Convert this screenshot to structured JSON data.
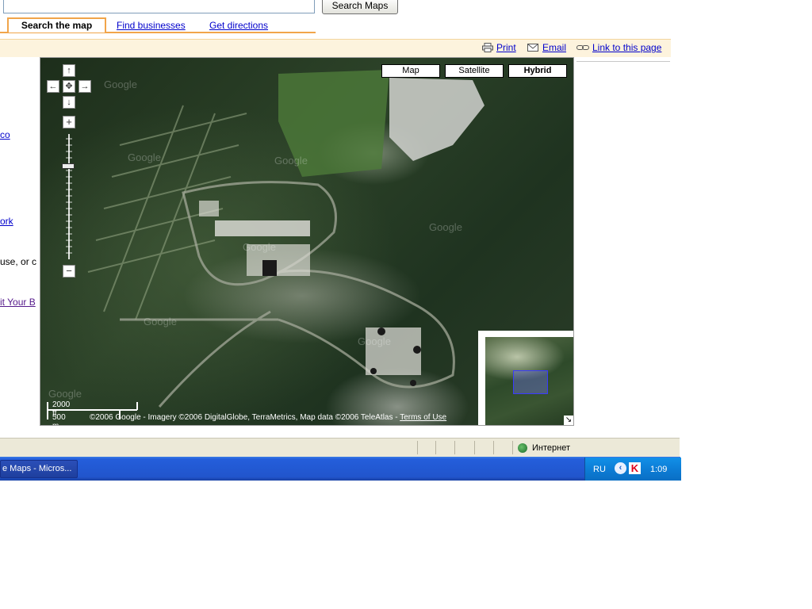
{
  "search": {
    "value": "",
    "button_label": "Search Maps"
  },
  "tabs": [
    {
      "label": "Search the map"
    },
    {
      "label": "Find businesses"
    },
    {
      "label": "Get directions"
    }
  ],
  "actions": {
    "print": "Print",
    "email": "Email",
    "link": "Link to this page"
  },
  "sidebar": {
    "line1": "co",
    "line2": "ork",
    "line3": "use, or c",
    "line4": "it Your B"
  },
  "map": {
    "types": [
      {
        "label": "Map"
      },
      {
        "label": "Satellite"
      },
      {
        "label": "Hybrid",
        "selected": true
      }
    ],
    "nav": {
      "up": "↑",
      "down": "↓",
      "left": "←",
      "right": "→",
      "center": "✥"
    },
    "zoom": {
      "in": "+",
      "out": "−"
    },
    "scale": {
      "imperial": "2000 ft",
      "metric": "500 m"
    },
    "copyright": "©2006 Google - Imagery ©2006 DigitalGlobe, TerraMetrics, Map data ©2006 TeleAtlas - ",
    "terms": "Terms of Use",
    "overview_toggle": "↘"
  },
  "status_bar": {
    "zone": "Интернет"
  },
  "taskbar": {
    "task": "e Maps - Micros...",
    "lang": "RU",
    "tray_arrow": "‹",
    "kaspersky": "K",
    "clock": "1:09"
  },
  "colors": {
    "tab_accent": "#f1a54a",
    "link": "#0000cc",
    "taskbar": "#245edb"
  }
}
